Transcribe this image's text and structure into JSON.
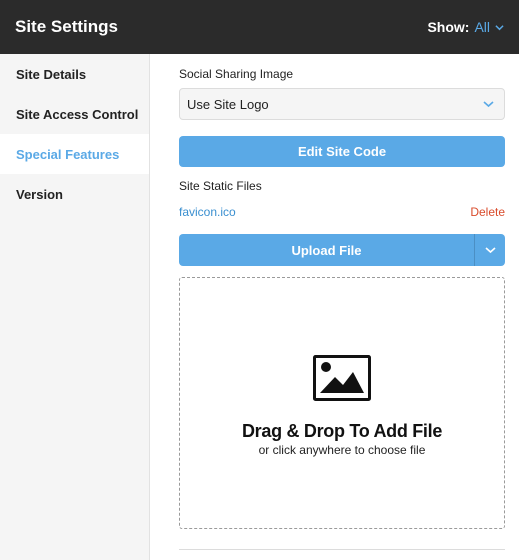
{
  "header": {
    "title": "Site Settings",
    "show_label": "Show:",
    "show_value": "All"
  },
  "sidebar": {
    "items": [
      {
        "label": "Site Details",
        "active": false
      },
      {
        "label": "Site Access Control",
        "active": false
      },
      {
        "label": "Special Features",
        "active": true
      },
      {
        "label": "Version",
        "active": false
      }
    ]
  },
  "social": {
    "label": "Social Sharing Image",
    "selected": "Use Site Logo"
  },
  "edit_code": {
    "label": "Edit Site Code"
  },
  "static_files": {
    "label": "Site Static Files",
    "files": [
      {
        "name": "favicon.ico",
        "action": "Delete"
      }
    ]
  },
  "upload": {
    "label": "Upload File"
  },
  "dropzone": {
    "title": "Drag & Drop To Add File",
    "subtitle": "or click anywhere to choose file",
    "icon": "image-icon"
  },
  "colors": {
    "header_bg": "#2b2b2b",
    "accent": "#5aa9e6",
    "delete": "#d94b2b"
  }
}
